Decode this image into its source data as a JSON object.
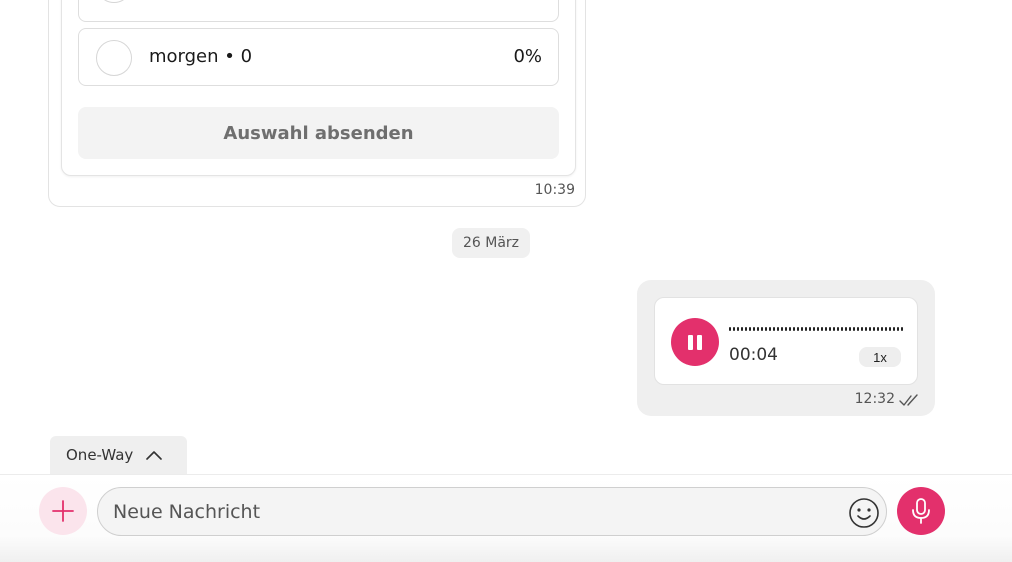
{
  "poll": {
    "option_partial": "",
    "option_label": "morgen • 0",
    "option_percent": "0%",
    "submit_label": "Auswahl absenden",
    "time": "10:39"
  },
  "date_divider": "26 März",
  "voice_message": {
    "duration": "00:04",
    "speed": "1x",
    "time": "12:32",
    "status_icon": "double-check-icon",
    "accent_color": "#e3306c"
  },
  "oneway_tab": {
    "label": "One-Way",
    "icon": "chevron-up-icon"
  },
  "composer": {
    "placeholder": "Neue Nachricht",
    "add_icon": "plus-icon",
    "emoji_icon": "smiley-icon",
    "mic_icon": "microphone-icon"
  }
}
